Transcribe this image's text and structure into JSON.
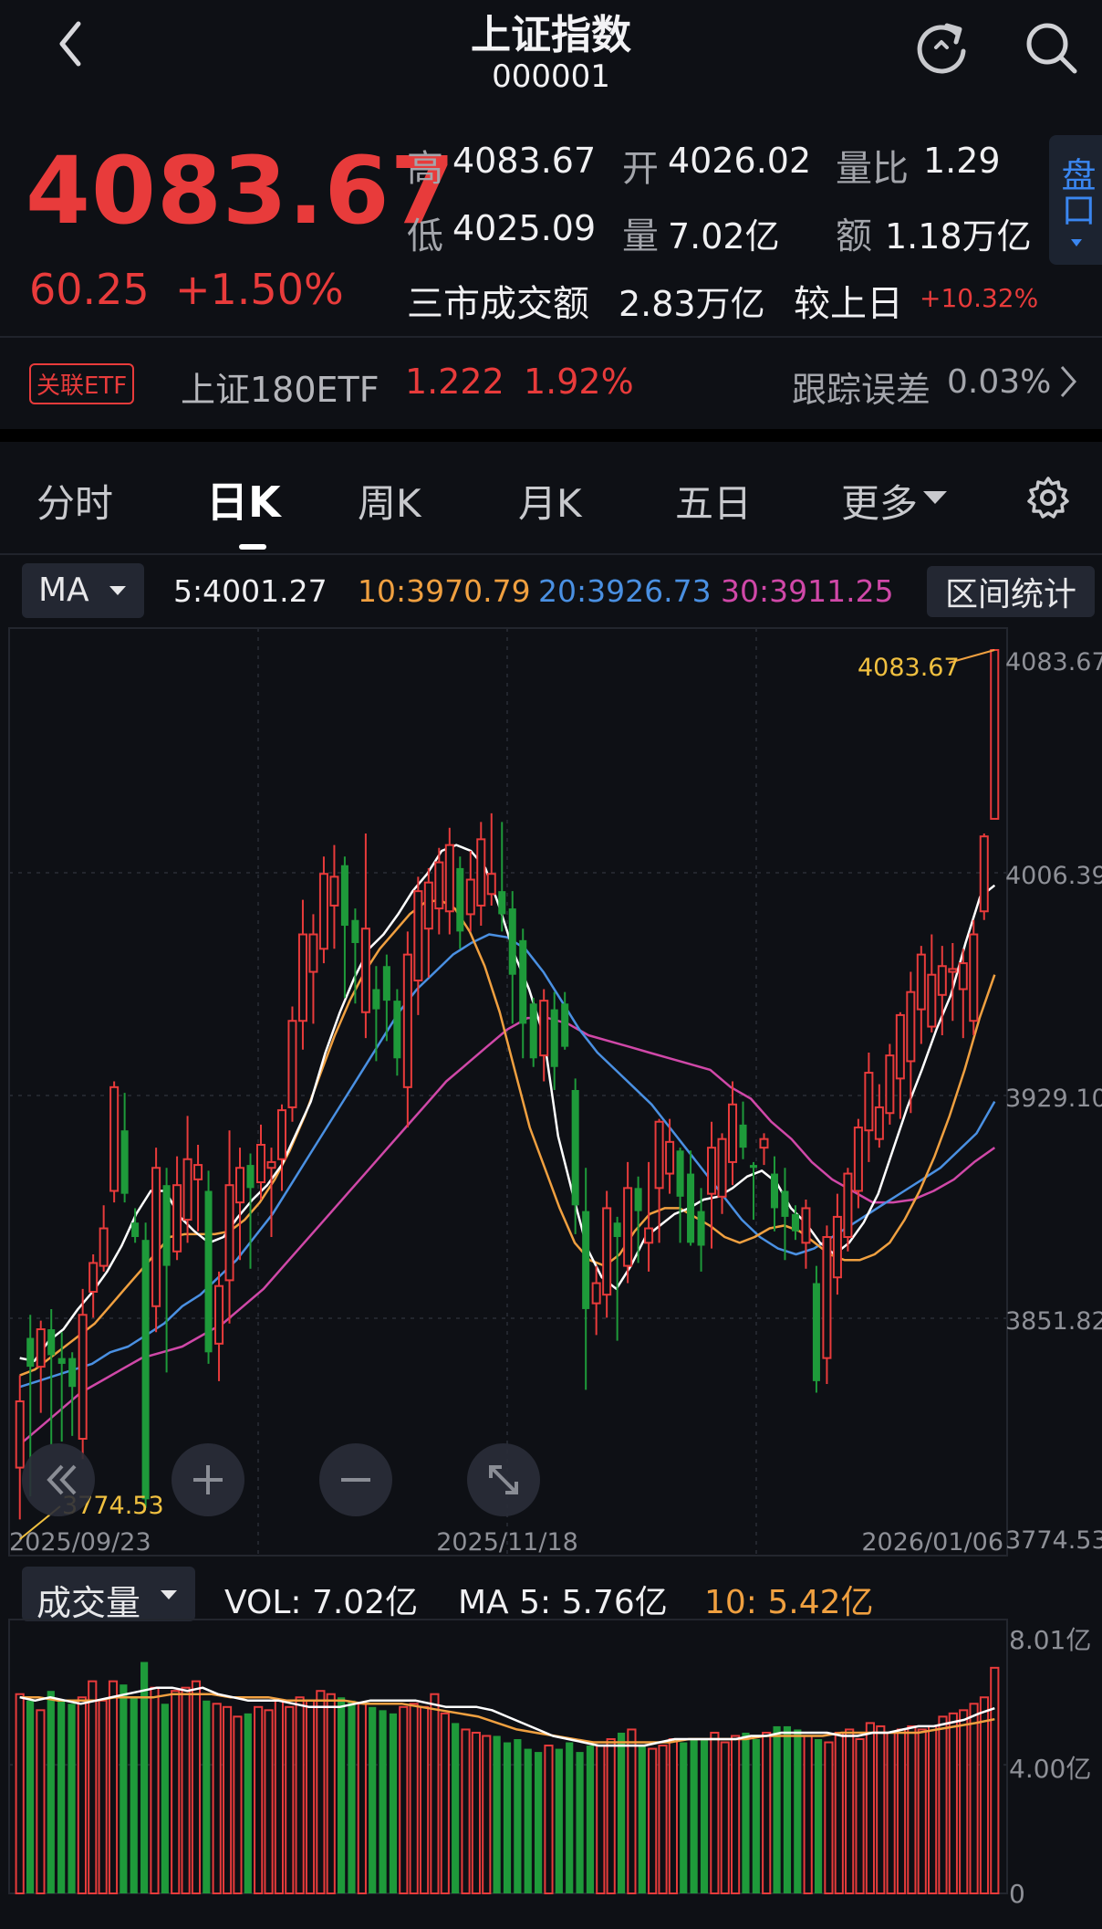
{
  "header": {
    "title": "上证指数",
    "code": "000001",
    "icons": [
      "back-icon",
      "refresh-icon",
      "search-icon"
    ]
  },
  "quote": {
    "price": "4083.67",
    "change": "60.25",
    "change_pct": "+1.50%",
    "high_label": "高",
    "high": "4083.67",
    "open_label": "开",
    "open": "4026.02",
    "vol_ratio_label": "量比",
    "vol_ratio": "1.29",
    "low_label": "低",
    "low": "4025.09",
    "volume_label": "量",
    "volume": "7.02亿",
    "amount_label": "额",
    "amount": "1.18万亿",
    "market_turnover_label": "三市成交额",
    "market_turnover": "2.83万亿",
    "vs_prev_label": "较上日",
    "vs_prev": "+10.32%",
    "pankou_label": "盘口"
  },
  "etf": {
    "tag": "关联ETF",
    "name": "上证180ETF",
    "price": "1.222",
    "pct": "1.92%",
    "tracking_label": "跟踪误差",
    "tracking_value": "0.03%"
  },
  "tabs": [
    "分时",
    "日K",
    "周K",
    "月K",
    "五日",
    "更多"
  ],
  "active_tab": "日K",
  "ma_legend": {
    "selector": "MA",
    "ma5": "5:4001.27",
    "ma10": "10:3970.79",
    "ma20": "20:3926.73",
    "ma30": "30:3911.25",
    "range_stats": "区间统计"
  },
  "colors": {
    "up": "#e83b3b",
    "down": "#1e9a3a",
    "ma5": "#ffffff",
    "ma10": "#f0a040",
    "ma20": "#4a90e2",
    "ma30": "#d048a8",
    "active_tab": "#ffffff",
    "pankou": "#3a86f0"
  },
  "chart_data": [
    {
      "type": "candlestick",
      "y_ticks": [
        "4083.67",
        "4006.39",
        "3929.10",
        "3851.82",
        "3774.53"
      ],
      "ylim": [
        3774.53,
        4083.67
      ],
      "x_labels": [
        "2025/09/23",
        "2025/11/18",
        "2026/01/06"
      ],
      "max_annotation": "4083.67",
      "min_annotation": "3774.53",
      "candles": [
        {
          "o": 3800,
          "c": 3823,
          "h": 3832,
          "l": 3782
        },
        {
          "o": 3845,
          "c": 3835,
          "h": 3853,
          "l": 3790
        },
        {
          "o": 3835,
          "c": 3848,
          "h": 3851,
          "l": 3819
        },
        {
          "o": 3848,
          "c": 3839,
          "h": 3855,
          "l": 3808
        },
        {
          "o": 3838,
          "c": 3836,
          "h": 3847,
          "l": 3809
        },
        {
          "o": 3838,
          "c": 3828,
          "h": 3840,
          "l": 3811
        },
        {
          "o": 3810,
          "c": 3853,
          "h": 3862,
          "l": 3803
        },
        {
          "o": 3861,
          "c": 3871,
          "h": 3874,
          "l": 3852
        },
        {
          "o": 3870,
          "c": 3883,
          "h": 3891,
          "l": 3868
        },
        {
          "o": 3896,
          "c": 3932,
          "h": 3934,
          "l": 3892
        },
        {
          "o": 3917,
          "c": 3895,
          "h": 3930,
          "l": 3892
        },
        {
          "o": 3885,
          "c": 3880,
          "h": 3890,
          "l": 3878
        },
        {
          "o": 3879,
          "c": 3789,
          "h": 3885,
          "l": 3786
        },
        {
          "o": 3856,
          "c": 3904,
          "h": 3911,
          "l": 3847
        },
        {
          "o": 3898,
          "c": 3870,
          "h": 3904,
          "l": 3833
        },
        {
          "o": 3875,
          "c": 3898,
          "h": 3908,
          "l": 3872
        },
        {
          "o": 3886,
          "c": 3907,
          "h": 3922,
          "l": 3878
        },
        {
          "o": 3900,
          "c": 3905,
          "h": 3912,
          "l": 3882
        },
        {
          "o": 3896,
          "c": 3840,
          "h": 3903,
          "l": 3836
        },
        {
          "o": 3843,
          "c": 3863,
          "h": 3868,
          "l": 3830
        },
        {
          "o": 3865,
          "c": 3898,
          "h": 3917,
          "l": 3850
        },
        {
          "o": 3892,
          "c": 3904,
          "h": 3911,
          "l": 3872
        },
        {
          "o": 3905,
          "c": 3897,
          "h": 3909,
          "l": 3869
        },
        {
          "o": 3899,
          "c": 3912,
          "h": 3919,
          "l": 3893
        },
        {
          "o": 3904,
          "c": 3906,
          "h": 3911,
          "l": 3880
        },
        {
          "o": 3907,
          "c": 3924,
          "h": 3926,
          "l": 3896
        },
        {
          "o": 3925,
          "c": 3955,
          "h": 3960,
          "l": 3920
        },
        {
          "o": 3955,
          "c": 3985,
          "h": 3997,
          "l": 3945
        },
        {
          "o": 3972,
          "c": 3985,
          "h": 3992,
          "l": 3954
        },
        {
          "o": 3980,
          "c": 4006,
          "h": 4012,
          "l": 3975
        },
        {
          "o": 3995,
          "c": 4005,
          "h": 4016,
          "l": 3980
        },
        {
          "o": 4009,
          "c": 3988,
          "h": 4012,
          "l": 3963
        },
        {
          "o": 3990,
          "c": 3982,
          "h": 3994,
          "l": 3961
        },
        {
          "o": 3958,
          "c": 3987,
          "h": 4020,
          "l": 3949
        },
        {
          "o": 3966,
          "c": 3959,
          "h": 3974,
          "l": 3941
        },
        {
          "o": 3974,
          "c": 3962,
          "h": 3978,
          "l": 3948
        },
        {
          "o": 3962,
          "c": 3942,
          "h": 3966,
          "l": 3936
        },
        {
          "o": 3932,
          "c": 3978,
          "h": 3986,
          "l": 3918
        },
        {
          "o": 3969,
          "c": 4000,
          "h": 4005,
          "l": 3957
        },
        {
          "o": 3987,
          "c": 4003,
          "h": 4008,
          "l": 3970
        },
        {
          "o": 3994,
          "c": 4010,
          "h": 4015,
          "l": 3985
        },
        {
          "o": 3993,
          "c": 4016,
          "h": 4022,
          "l": 3985
        },
        {
          "o": 4008,
          "c": 3986,
          "h": 4012,
          "l": 3980
        },
        {
          "o": 3992,
          "c": 4004,
          "h": 4014,
          "l": 3986
        },
        {
          "o": 3995,
          "c": 4018,
          "h": 4024,
          "l": 3988
        },
        {
          "o": 3999,
          "c": 4006,
          "h": 4027,
          "l": 3995
        },
        {
          "o": 4000,
          "c": 3992,
          "h": 4024,
          "l": 3986
        },
        {
          "o": 3994,
          "c": 3971,
          "h": 4000,
          "l": 3954
        },
        {
          "o": 3983,
          "c": 3954,
          "h": 3987,
          "l": 3942
        },
        {
          "o": 3961,
          "c": 3942,
          "h": 3963,
          "l": 3939
        },
        {
          "o": 3943,
          "c": 3962,
          "h": 3966,
          "l": 3934
        },
        {
          "o": 3959,
          "c": 3939,
          "h": 3965,
          "l": 3931
        },
        {
          "o": 3961,
          "c": 3946,
          "h": 3965,
          "l": 3945
        },
        {
          "o": 3931,
          "c": 3891,
          "h": 3935,
          "l": 3881
        },
        {
          "o": 3889,
          "c": 3855,
          "h": 3904,
          "l": 3827
        },
        {
          "o": 3857,
          "c": 3864,
          "h": 3870,
          "l": 3846
        },
        {
          "o": 3860,
          "c": 3890,
          "h": 3896,
          "l": 3852
        },
        {
          "o": 3885,
          "c": 3880,
          "h": 3887,
          "l": 3844
        },
        {
          "o": 3870,
          "c": 3897,
          "h": 3906,
          "l": 3864
        },
        {
          "o": 3897,
          "c": 3889,
          "h": 3901,
          "l": 3871
        },
        {
          "o": 3878,
          "c": 3883,
          "h": 3906,
          "l": 3868
        },
        {
          "o": 3897,
          "c": 3920,
          "h": 3921,
          "l": 3878
        },
        {
          "o": 3902,
          "c": 3913,
          "h": 3921,
          "l": 3895
        },
        {
          "o": 3910,
          "c": 3894,
          "h": 3911,
          "l": 3878
        },
        {
          "o": 3902,
          "c": 3878,
          "h": 3910,
          "l": 3877
        },
        {
          "o": 3889,
          "c": 3877,
          "h": 3897,
          "l": 3868
        },
        {
          "o": 3895,
          "c": 3911,
          "h": 3920,
          "l": 3876
        },
        {
          "o": 3894,
          "c": 3914,
          "h": 3916,
          "l": 3888
        },
        {
          "o": 3906,
          "c": 3926,
          "h": 3934,
          "l": 3898
        },
        {
          "o": 3919,
          "c": 3911,
          "h": 3927,
          "l": 3907
        },
        {
          "o": 3905,
          "c": 3904,
          "h": 3906,
          "l": 3886
        },
        {
          "o": 3911,
          "c": 3914,
          "h": 3916,
          "l": 3905
        },
        {
          "o": 3902,
          "c": 3890,
          "h": 3908,
          "l": 3882
        },
        {
          "o": 3896,
          "c": 3887,
          "h": 3904,
          "l": 3872
        },
        {
          "o": 3888,
          "c": 3882,
          "h": 3891,
          "l": 3879
        },
        {
          "o": 3878,
          "c": 3890,
          "h": 3893,
          "l": 3869
        },
        {
          "o": 3864,
          "c": 3830,
          "h": 3870,
          "l": 3826
        },
        {
          "o": 3838,
          "c": 3880,
          "h": 3884,
          "l": 3829
        },
        {
          "o": 3866,
          "c": 3887,
          "h": 3895,
          "l": 3860
        },
        {
          "o": 3880,
          "c": 3902,
          "h": 3904,
          "l": 3875
        },
        {
          "o": 3896,
          "c": 3918,
          "h": 3921,
          "l": 3890
        },
        {
          "o": 3917,
          "c": 3937,
          "h": 3944,
          "l": 3906
        },
        {
          "o": 3914,
          "c": 3925,
          "h": 3933,
          "l": 3911
        },
        {
          "o": 3923,
          "c": 3943,
          "h": 3947,
          "l": 3919
        },
        {
          "o": 3935,
          "c": 3957,
          "h": 3958,
          "l": 3921
        },
        {
          "o": 3941,
          "c": 3965,
          "h": 3972,
          "l": 3923
        },
        {
          "o": 3959,
          "c": 3978,
          "h": 3981,
          "l": 3947
        },
        {
          "o": 3953,
          "c": 3971,
          "h": 3985,
          "l": 3951
        },
        {
          "o": 3964,
          "c": 3974,
          "h": 3981,
          "l": 3950
        },
        {
          "o": 3972,
          "c": 3973,
          "h": 3982,
          "l": 3955
        },
        {
          "o": 3966,
          "c": 3975,
          "h": 3980,
          "l": 3949
        },
        {
          "o": 3955,
          "c": 3985,
          "h": 3990,
          "l": 3950
        },
        {
          "o": 3993,
          "c": 4019,
          "h": 4020,
          "l": 3990
        },
        {
          "o": 4025.09,
          "c": 4083.67,
          "h": 4083.67,
          "l": 4025.09
        }
      ],
      "ma5": [
        3838,
        3837,
        3844,
        3848,
        3855,
        3861,
        3868,
        3877,
        3888,
        3896,
        3896,
        3887,
        3882,
        3878,
        3880,
        3887,
        3893,
        3898,
        3905,
        3916,
        3927,
        3944,
        3958,
        3970,
        3980,
        3985,
        3992,
        4000,
        4006,
        4014,
        4016,
        4014,
        4008,
        3994,
        3978,
        3966,
        3950,
        3915,
        3895,
        3876,
        3866,
        3862,
        3870,
        3880,
        3884,
        3888,
        3890,
        3893,
        3894,
        3897,
        3901,
        3903,
        3899,
        3890,
        3885,
        3878,
        3874,
        3878,
        3885,
        3895,
        3910,
        3925,
        3938,
        3952,
        3964,
        3982,
        3998,
        4002
      ],
      "ma10": [
        3832,
        3834,
        3838,
        3842,
        3846,
        3850,
        3856,
        3862,
        3868,
        3874,
        3880,
        3881,
        3881,
        3881,
        3882,
        3886,
        3892,
        3900,
        3910,
        3922,
        3936,
        3950,
        3962,
        3972,
        3980,
        3986,
        3992,
        3996,
        3997,
        3994,
        3986,
        3974,
        3958,
        3938,
        3918,
        3904,
        3890,
        3878,
        3872,
        3870,
        3874,
        3882,
        3888,
        3890,
        3890,
        3887,
        3884,
        3880,
        3878,
        3880,
        3883,
        3884,
        3882,
        3878,
        3874,
        3872,
        3872,
        3874,
        3878,
        3886,
        3896,
        3908,
        3922,
        3938,
        3956,
        3971
      ],
      "ma20": [
        3828,
        3830,
        3832,
        3834,
        3836,
        3840,
        3842,
        3846,
        3850,
        3856,
        3860,
        3866,
        3872,
        3880,
        3888,
        3898,
        3908,
        3918,
        3928,
        3938,
        3948,
        3958,
        3966,
        3972,
        3978,
        3982,
        3985,
        3984,
        3980,
        3972,
        3962,
        3952,
        3944,
        3938,
        3932,
        3926,
        3918,
        3910,
        3902,
        3894,
        3886,
        3880,
        3876,
        3874,
        3876,
        3880,
        3884,
        3888,
        3892,
        3896,
        3900,
        3904,
        3910,
        3916,
        3927
      ],
      "ma30": [
        3808,
        3814,
        3820,
        3826,
        3830,
        3834,
        3838,
        3840,
        3842,
        3846,
        3850,
        3856,
        3862,
        3870,
        3878,
        3886,
        3894,
        3902,
        3910,
        3918,
        3926,
        3934,
        3940,
        3946,
        3952,
        3956,
        3956,
        3954,
        3950,
        3948,
        3946,
        3944,
        3942,
        3940,
        3938,
        3932,
        3928,
        3920,
        3914,
        3906,
        3900,
        3896,
        3892,
        3892,
        3893,
        3896,
        3900,
        3906,
        3911
      ]
    },
    {
      "type": "bar",
      "legend_selector": "成交量",
      "vol": "VOL: 7.02亿",
      "ma5_label": "MA 5: 5.76亿",
      "ma10_label": "10: 5.42亿",
      "y_ticks": [
        "8.01亿",
        "4.00亿",
        "0"
      ],
      "ylim": [
        0,
        8.01
      ],
      "values": [
        6.2,
        6.0,
        5.7,
        6.3,
        6.0,
        5.9,
        6.1,
        6.6,
        6.0,
        6.6,
        6.5,
        6.1,
        7.2,
        6.4,
        5.9,
        6.3,
        6.4,
        6.6,
        6.0,
        5.9,
        5.8,
        5.5,
        5.6,
        5.8,
        5.7,
        6.0,
        5.8,
        6.1,
        6.0,
        6.3,
        6.2,
        6.1,
        6.0,
        5.9,
        5.8,
        5.7,
        5.6,
        5.8,
        5.9,
        5.8,
        6.2,
        5.6,
        5.3,
        5.1,
        5.0,
        4.9,
        4.9,
        4.7,
        4.8,
        4.5,
        4.4,
        4.6,
        4.5,
        4.7,
        4.4,
        4.6,
        4.6,
        4.8,
        5.0,
        5.1,
        4.6,
        4.5,
        4.6,
        4.8,
        4.7,
        4.8,
        4.8,
        5.0,
        4.7,
        4.9,
        5.0,
        4.8,
        5.0,
        5.2,
        5.2,
        5.1,
        4.9,
        4.8,
        4.7,
        5.0,
        5.1,
        4.8,
        5.3,
        5.2,
        5.0,
        5.1,
        5.2,
        5.1,
        5.2,
        5.5,
        5.6,
        5.7,
        5.9,
        6.1,
        7.02
      ],
      "ma5": [
        6.1,
        6.0,
        6.1,
        6.0,
        5.9,
        6.0,
        6.1,
        6.2,
        6.3,
        6.4,
        6.4,
        6.3,
        6.4,
        6.2,
        6.1,
        6.0,
        6.0,
        6.0,
        5.9,
        5.8,
        5.8,
        5.8,
        5.9,
        6.0,
        6.0,
        6.0,
        6.0,
        5.9,
        5.8,
        5.8,
        5.8,
        5.7,
        5.5,
        5.3,
        5.1,
        4.9,
        4.8,
        4.7,
        4.6,
        4.6,
        4.6,
        4.6,
        4.7,
        4.8,
        4.8,
        4.8,
        4.8,
        4.8,
        4.9,
        4.9,
        5.0,
        5.0,
        5.0,
        5.0,
        4.9,
        4.9,
        5.0,
        5.0,
        5.1,
        5.2,
        5.2,
        5.3,
        5.4,
        5.6,
        5.76
      ],
      "ma10": [
        6.1,
        6.1,
        6.0,
        6.0,
        6.0,
        6.1,
        6.1,
        6.1,
        6.2,
        6.2,
        6.2,
        6.1,
        6.1,
        6.1,
        6.0,
        6.0,
        6.0,
        6.0,
        5.9,
        5.9,
        5.9,
        5.8,
        5.7,
        5.6,
        5.5,
        5.3,
        5.1,
        5.0,
        4.9,
        4.8,
        4.7,
        4.7,
        4.7,
        4.7,
        4.7,
        4.8,
        4.8,
        4.8,
        4.8,
        4.9,
        4.9,
        4.9,
        4.9,
        5.0,
        5.0,
        5.0,
        5.0,
        5.0,
        5.1,
        5.2,
        5.3,
        5.42
      ]
    }
  ],
  "chart_controls": [
    "rewind-icon",
    "zoom-in-icon",
    "zoom-out-icon",
    "fullscreen-icon"
  ]
}
